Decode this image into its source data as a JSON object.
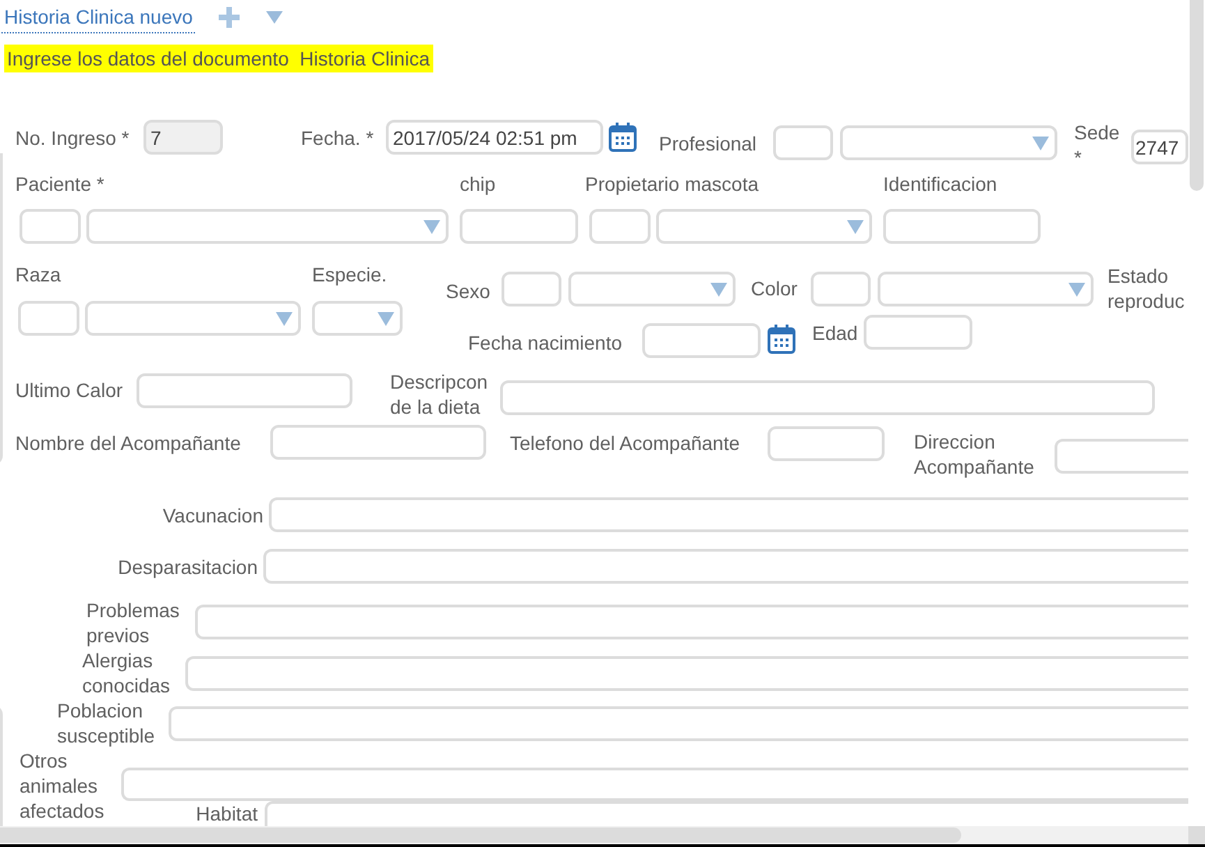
{
  "header": {
    "title": "Historia Clinica nuevo"
  },
  "notice": "Ingrese los datos del documento  Historia Clinica",
  "fields": {
    "no_ingreso": {
      "label": "No. Ingreso *",
      "value": "7",
      "disabled": true
    },
    "fecha": {
      "label": "Fecha. *",
      "value": "2017/05/24 02:51 pm"
    },
    "profesional": {
      "label": "Profesional"
    },
    "sede": {
      "label": "Sede *",
      "value": "2747"
    },
    "paciente": {
      "label": "Paciente *"
    },
    "chip": {
      "label": "chip"
    },
    "propietario_mascota": {
      "label": "Propietario mascota"
    },
    "identificacion": {
      "label": "Identificacion"
    },
    "raza": {
      "label": "Raza"
    },
    "especie": {
      "label": "Especie."
    },
    "sexo": {
      "label": "Sexo"
    },
    "color": {
      "label": "Color"
    },
    "estado_reproduc": {
      "label": "Estado reproduc"
    },
    "fecha_nacimiento": {
      "label": "Fecha nacimiento"
    },
    "edad": {
      "label": "Edad"
    },
    "ultimo_calor": {
      "label": "Ultimo Calor"
    },
    "descripcion_dieta": {
      "label": "Descripcon de la dieta"
    },
    "nombre_acompanante": {
      "label": "Nombre del Acompañante"
    },
    "telefono_acompanante": {
      "label": "Telefono del Acompañante"
    },
    "direccion_acompanante": {
      "label": "Direccion Acompañante"
    }
  },
  "history": [
    {
      "label": "Vacunacion"
    },
    {
      "label": "Desparasitacion"
    },
    {
      "label": "Problemas previos"
    },
    {
      "label": "Alergias conocidas"
    },
    {
      "label": "Poblacion susceptible"
    },
    {
      "label": "Otros animales afectados"
    },
    {
      "label": "Habitat"
    }
  ]
}
